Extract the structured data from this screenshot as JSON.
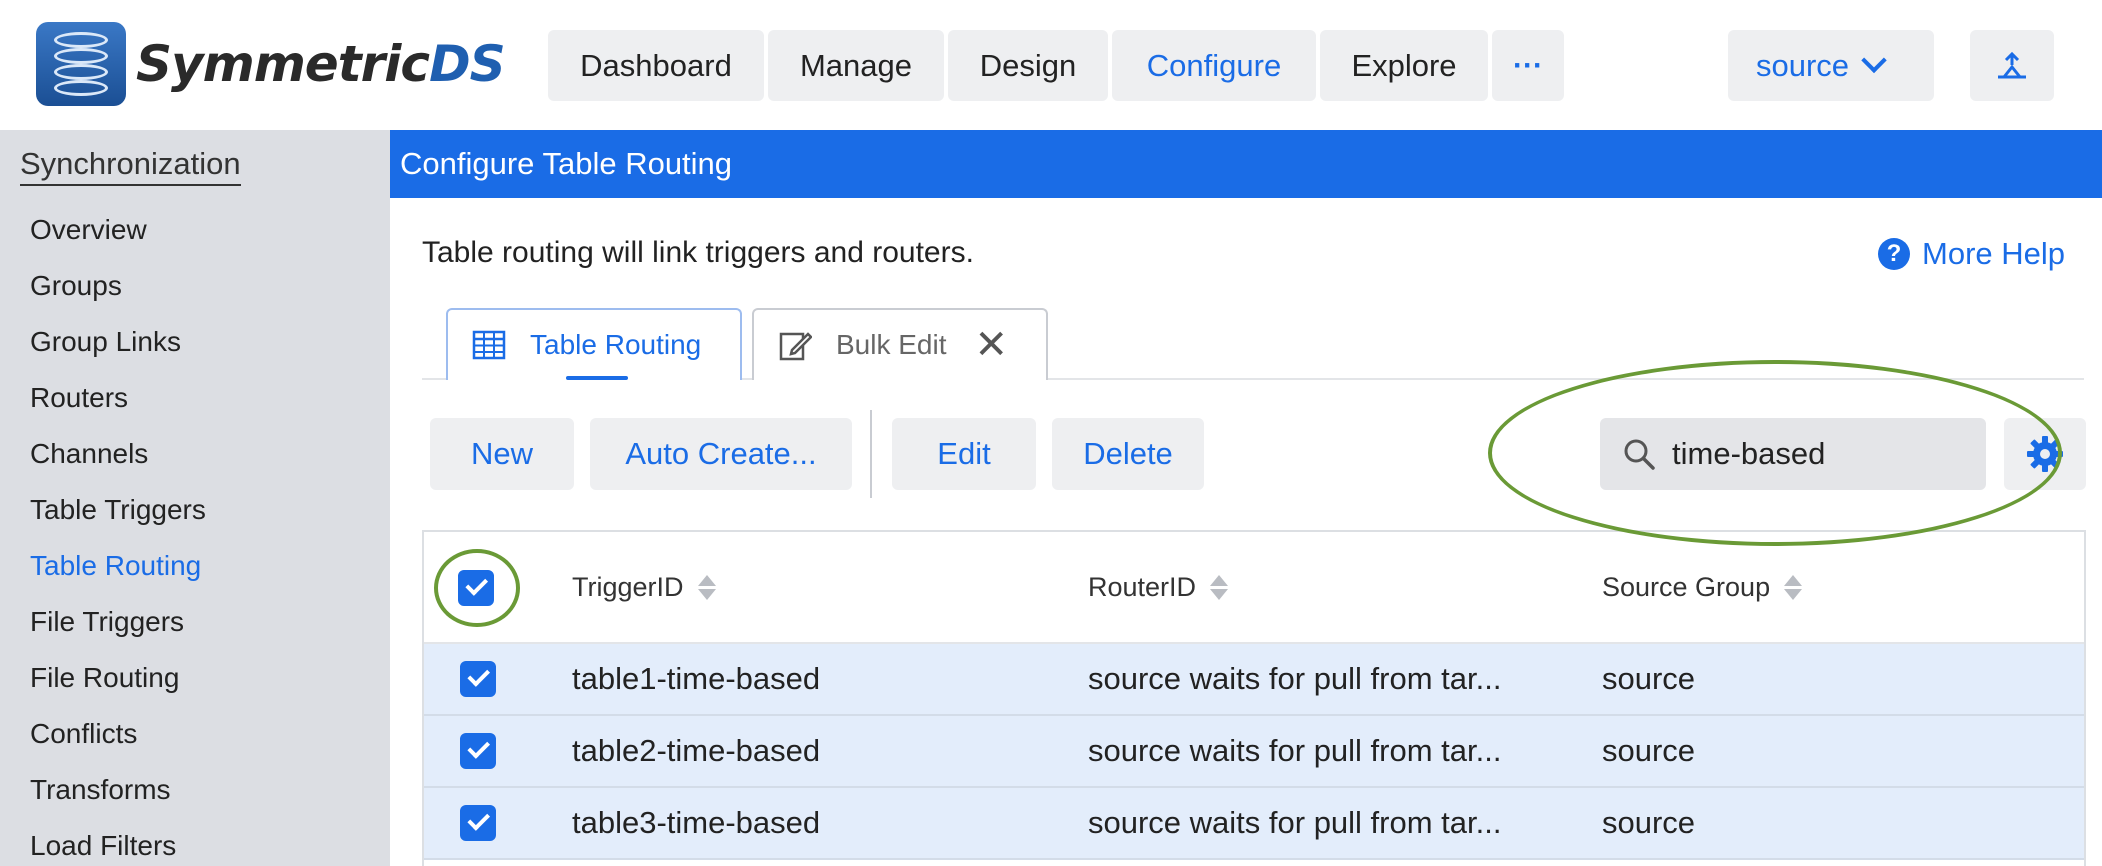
{
  "brand": {
    "name_part1": "Symmetric",
    "name_part2": "DS"
  },
  "nav": {
    "items": [
      {
        "label": "Dashboard"
      },
      {
        "label": "Manage"
      },
      {
        "label": "Design"
      },
      {
        "label": "Configure",
        "active": true
      },
      {
        "label": "Explore"
      }
    ],
    "more_label": "···"
  },
  "node_select": {
    "value": "source"
  },
  "sidebar": {
    "title": "Synchronization",
    "items": [
      {
        "label": "Overview"
      },
      {
        "label": "Groups"
      },
      {
        "label": "Group Links"
      },
      {
        "label": "Routers"
      },
      {
        "label": "Channels"
      },
      {
        "label": "Table Triggers"
      },
      {
        "label": "Table Routing",
        "active": true
      },
      {
        "label": "File Triggers"
      },
      {
        "label": "File Routing"
      },
      {
        "label": "Conflicts"
      },
      {
        "label": "Transforms"
      },
      {
        "label": "Load Filters"
      }
    ]
  },
  "page": {
    "title": "Configure Table Routing",
    "description": "Table routing will link triggers and routers.",
    "help_label": "More Help"
  },
  "tabs": [
    {
      "label": "Table Routing",
      "active": true
    },
    {
      "label": "Bulk Edit",
      "closable": true
    }
  ],
  "toolbar": {
    "new_label": "New",
    "auto_create_label": "Auto Create...",
    "edit_label": "Edit",
    "delete_label": "Delete"
  },
  "search": {
    "value": "time-based"
  },
  "table": {
    "columns": [
      "TriggerID",
      "RouterID",
      "Source Group"
    ],
    "header_checked": true,
    "rows": [
      {
        "checked": true,
        "trigger_id": "table1-time-based",
        "router_id": "source waits for pull from tar...",
        "source_group": "source"
      },
      {
        "checked": true,
        "trigger_id": "table2-time-based",
        "router_id": "source waits for pull from tar...",
        "source_group": "source"
      },
      {
        "checked": true,
        "trigger_id": "table3-time-based",
        "router_id": "source waits for pull from tar...",
        "source_group": "source"
      }
    ]
  },
  "colors": {
    "accent": "#1a6ce6",
    "sidebar_bg": "#dcdee3",
    "row_selected_bg": "#e3edfb",
    "annotation_ellipse": "#6a9a36"
  }
}
